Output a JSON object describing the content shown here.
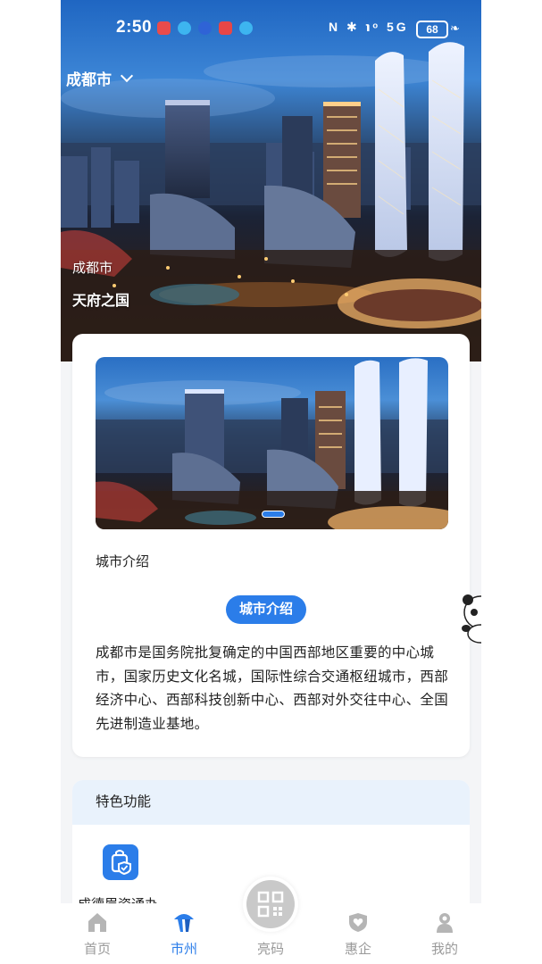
{
  "status": {
    "time": "2:50",
    "signal_icons": "N ✱ ℩ᵒ 5G",
    "battery": "68"
  },
  "header": {
    "city_selector": "成都市"
  },
  "hero": {
    "city_name": "成都市",
    "slogan": "天府之国"
  },
  "intro_card": {
    "section_label": "城市介绍",
    "pill_label": "城市介绍",
    "text": "成都市是国务院批复确定的中国西部地区重要的中心城市，国家历史文化名城，国际性综合交通枢纽城市，西部经济中心、西部科技创新中心、西部对外交往中心、全国先进制造业基地。"
  },
  "features": {
    "title": "特色功能",
    "items": [
      {
        "label": "成德眉资通办",
        "icon": "shopping-bag-shield-icon"
      }
    ]
  },
  "tabbar": {
    "tabs": [
      {
        "label": "首页",
        "icon": "home-icon"
      },
      {
        "label": "市州",
        "icon": "city-landmark-icon"
      },
      {
        "label": "亮码",
        "icon": "qr-code-icon"
      },
      {
        "label": "惠企",
        "icon": "heart-shield-icon"
      },
      {
        "label": "我的",
        "icon": "user-icon"
      }
    ],
    "active": "市州"
  },
  "colors": {
    "accent": "#2b7de9",
    "tab_inactive": "#9a9a9a",
    "features_header_bg": "#e9f2fc"
  }
}
